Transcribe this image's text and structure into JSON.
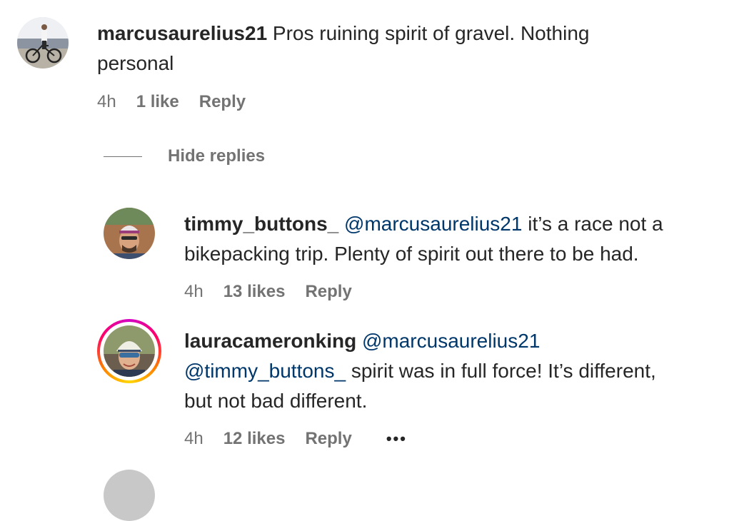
{
  "comments": [
    {
      "username": "marcusaurelius21",
      "text_line1": " Pros ruining spirit of gravel. Nothing",
      "text_line2": "personal",
      "time": "4h",
      "likes": "1 like",
      "reply": "Reply"
    }
  ],
  "hide_replies": "Hide replies",
  "replies": [
    {
      "username": "timmy_buttons_",
      "mention": "@marcusaurelius21",
      "text_line1_rest": " it’s a race not a",
      "text_line2": "bikepacking trip. Plenty of spirit out there to be had.",
      "time": "4h",
      "likes": "13 likes",
      "reply": "Reply"
    },
    {
      "username": "lauracameronking",
      "mention1": "@marcusaurelius21",
      "mention2": "@timmy_buttons_",
      "text_line2_rest": " spirit was in full force! It’s different,",
      "text_line3": "but not bad different.",
      "time": "4h",
      "likes": "12 likes",
      "reply": "Reply",
      "more": "•••"
    }
  ],
  "colors": {
    "text": "#262626",
    "muted": "#737373",
    "mention": "#00376b"
  }
}
